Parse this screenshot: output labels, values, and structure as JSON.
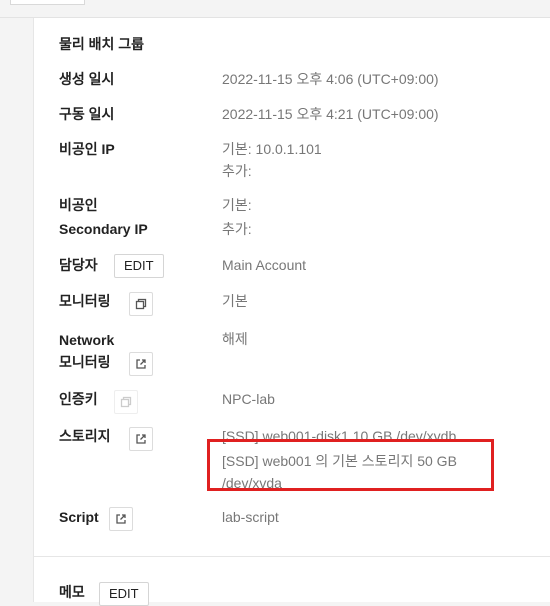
{
  "rows": {
    "placement_group": {
      "label": "물리 배치 그룹"
    },
    "created": {
      "label": "생성 일시",
      "value": "2022-11-15 오후 4:06 (UTC+09:00)"
    },
    "started": {
      "label": "구동 일시",
      "value": "2022-11-15 오후 4:21 (UTC+09:00)"
    },
    "private_ip": {
      "label": "비공인 IP",
      "value_line1": "기본: 10.0.1.101",
      "value_line2": "추가:"
    },
    "secondary_ip": {
      "label_line1": "비공인",
      "label_line2": "Secondary IP",
      "value_line1": "기본:",
      "value_line2": "추가:"
    },
    "manager": {
      "label": "담당자",
      "button": "EDIT",
      "value": "Main Account"
    },
    "monitoring": {
      "label": "모니터링",
      "value": "기본"
    },
    "network_monitoring": {
      "label_line1": "Network",
      "label_line2": "모니터링",
      "value": "해제"
    },
    "auth_key": {
      "label": "인증키",
      "value": "NPC-lab"
    },
    "storage": {
      "label": "스토리지",
      "items": [
        "[SSD] web001-disk1  10 GB /dev/xvdb",
        "[SSD] web001 의 기본 스토리지  50 GB",
        "/dev/xvda"
      ]
    },
    "script": {
      "label": "Script",
      "value": "lab-script"
    },
    "memo": {
      "label": "메모",
      "button": "EDIT"
    }
  },
  "icons": {
    "monitoring": "window-restore-icon",
    "network_monitoring": "external-link-icon",
    "auth_key": "window-restore-icon",
    "storage": "external-link-icon",
    "script": "external-link-icon"
  },
  "colors": {
    "highlight": "#e02020",
    "value_text": "#777777",
    "label_text": "#222222"
  }
}
